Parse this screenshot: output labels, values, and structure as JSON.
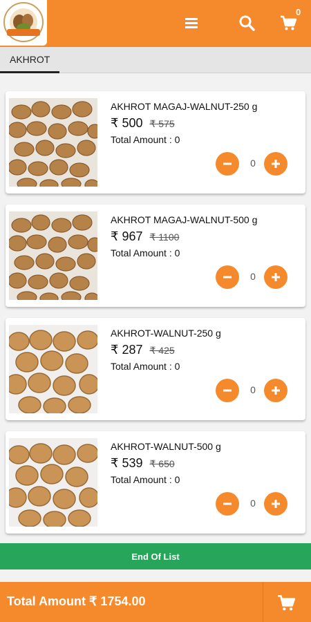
{
  "header": {
    "cart_count": "0",
    "brand_color": "#f58a2c",
    "icons": [
      "menu-icon",
      "search-icon",
      "cart-icon"
    ]
  },
  "tabs": [
    {
      "label": "AKHROT",
      "active": true
    }
  ],
  "products": [
    {
      "name": "AKHROT MAGAJ-WALNUT-250 g",
      "price": "₹ 500",
      "mrp": "₹ 575",
      "total": "Total Amount : 0",
      "qty": "0",
      "image": "walnut-kernels"
    },
    {
      "name": "AKHROT MAGAJ-WALNUT-500 g",
      "price": "₹ 967",
      "mrp": "₹ 1100",
      "total": "Total Amount : 0",
      "qty": "0",
      "image": "walnut-kernels"
    },
    {
      "name": "AKHROT-WALNUT-250 g",
      "price": "₹ 287",
      "mrp": "₹ 425",
      "total": "Total Amount : 0",
      "qty": "0",
      "image": "whole-walnuts"
    },
    {
      "name": "AKHROT-WALNUT-500 g",
      "price": "₹ 539",
      "mrp": "₹ 650",
      "total": "Total Amount : 0",
      "qty": "0",
      "image": "whole-walnuts"
    }
  ],
  "end_of_list": "End Of List",
  "footer": {
    "total_label": "Total Amount ₹ 1754.00"
  },
  "colors": {
    "accent": "#f58a2c",
    "success": "#27a55a"
  }
}
